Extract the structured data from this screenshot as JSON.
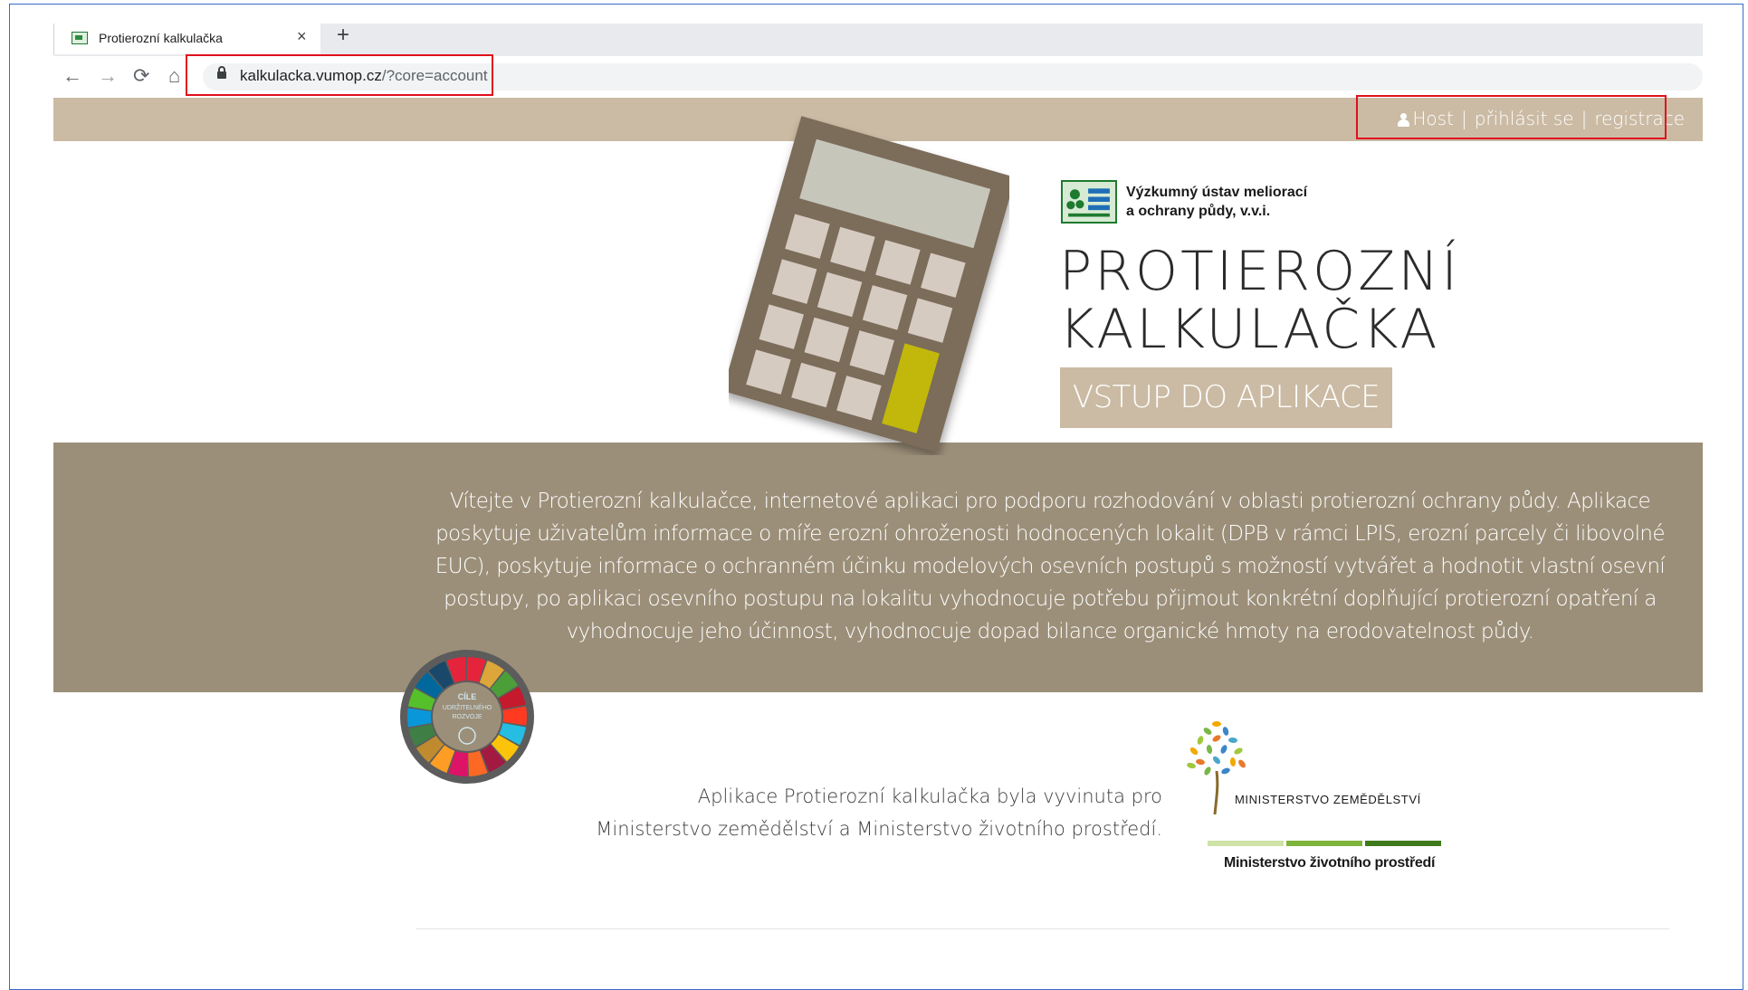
{
  "browser": {
    "tab_title": "Protierozní kalkulačka",
    "tab_close": "×",
    "new_tab": "+",
    "back": "←",
    "forward": "→",
    "reload": "⟳",
    "home": "⌂",
    "url_host": "kalkulacka.vumop.cz",
    "url_path": "/?core=account"
  },
  "header": {
    "user": "Host",
    "separator": "|",
    "login": "přihlásit se",
    "register": "registrace"
  },
  "hero": {
    "institute_line1": "Výzkumný ústav meliorací",
    "institute_line2": "a ochrany půdy, v.v.i.",
    "title_line1": "PROTIEROZNÍ",
    "title_line2": "KALKULAČKA",
    "enter_button": "VSTUP DO APLIKACE"
  },
  "intro": {
    "text": "Vítejte v Protierozní kalkulačce, internetové aplikaci pro podporu rozhodování v oblasti protierozní ochrany půdy. Aplikace poskytuje uživatelům informace o míře erozní ohroženosti hodnocených lokalit (DPB v rámci LPIS, erozní parcely či libovolné EUC), poskytuje informace o ochranném účinku modelových osevních postupů s možností vytvářet a hodnotit vlastní osevní postupy, po aplikaci osevního postupu na lokalitu vyhodnocuje potřebu přijmout konkrétní doplňující protierozní opatření a vyhodnocuje jeho účinnost, vyhodnocuje dopad bilance organické hmoty na erodovatelnost půdy."
  },
  "sdg": {
    "line1": "CÍLE",
    "line2": "UDRŽITELNÉHO",
    "line3": "ROZVOJE"
  },
  "footer": {
    "note_line1": "Aplikace Protierozní kalkulačka byla vyvinuta pro",
    "note_line2": "Ministerstvo zemědělství a Ministerstvo životního prostředí.",
    "mze_name": "MINISTERSTVO ZEMĚDĚLSTVÍ",
    "mzp_name": "Ministerstvo životního prostředí"
  },
  "colors": {
    "header_bar": "#cbbba4",
    "band": "#9c8f79",
    "calculator_body": "#7c6c5a",
    "calculator_display": "#c7c6bb",
    "calculator_accent": "#c2b80b",
    "highlight": "#e0101d"
  }
}
